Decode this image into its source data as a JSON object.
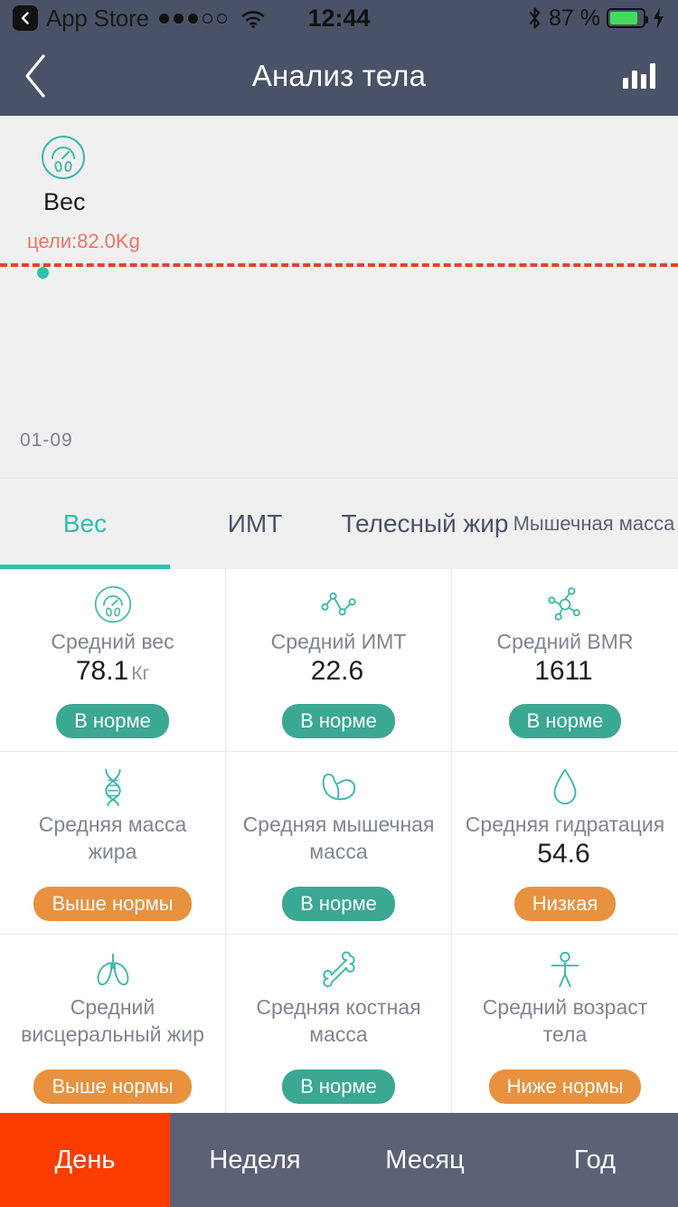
{
  "status_bar": {
    "back_app": "App Store",
    "signal_dots_filled": 3,
    "signal_dots_total": 5,
    "wifi_icon": "wifi-icon",
    "time": "12:44",
    "bluetooth_icon": "bluetooth-icon",
    "battery_percent": "87 %",
    "battery_level": 87,
    "charging_icon": "lightning-bolt-icon",
    "battery_color": "#44db5e"
  },
  "nav": {
    "back_icon": "chevron-left-icon",
    "title": "Анализ тела",
    "right_icon": "bar-chart-icon",
    "background": "#4a5268"
  },
  "chart_data": {
    "type": "scatter",
    "title": "Вес",
    "metric_icon": "body-scale-icon",
    "goal_label": "цели:82.0Kg",
    "goal_value": 82.0,
    "goal_unit": "Kg",
    "goal_line_color": "#e7412a",
    "point_color": "#30bfae",
    "categories": [
      "01-09"
    ],
    "x": [
      "01-09"
    ],
    "values": [
      81.4
    ],
    "series": [
      {
        "name": "Вес",
        "values": [
          81.4
        ]
      }
    ],
    "xlabel": "",
    "ylabel": "",
    "grid": false,
    "legend": "none",
    "annotations": [
      "цели:82.0Kg"
    ]
  },
  "tabs": {
    "active_index": 0,
    "accent": "#30bfae",
    "items": [
      {
        "label": "Вес"
      },
      {
        "label": "ИМТ"
      },
      {
        "label": "Телесный жир"
      },
      {
        "label": "Мышечная масса"
      }
    ]
  },
  "cards": [
    {
      "icon": "body-scale-icon",
      "title": "Средний вес",
      "value": "78.1",
      "unit": "Кг",
      "badge": "В норме",
      "badge_type": "ok"
    },
    {
      "icon": "line-chart-icon",
      "title": "Средний ИМТ",
      "value": "22.6",
      "unit": "",
      "badge": "В норме",
      "badge_type": "ok"
    },
    {
      "icon": "molecule-icon",
      "title": "Средний BMR",
      "value": "1611",
      "unit": "",
      "badge": "В норме",
      "badge_type": "ok"
    },
    {
      "icon": "dna-helix-icon",
      "title": "Средняя масса\nжира",
      "value": "",
      "unit": "",
      "badge": "Выше нормы",
      "badge_type": "warn"
    },
    {
      "icon": "flexed-biceps-icon",
      "title": "Средняя мышечная\nмасса",
      "value": "",
      "unit": "",
      "badge": "В норме",
      "badge_type": "ok"
    },
    {
      "icon": "water-drop-icon",
      "title": "Средняя гидратация",
      "value": "54.6",
      "unit": "",
      "badge": "Низкая",
      "badge_type": "warn"
    },
    {
      "icon": "lungs-icon",
      "title": "Средний\nвисцеральный жир",
      "value": "",
      "unit": "",
      "badge": "Выше нормы",
      "badge_type": "warn"
    },
    {
      "icon": "bone-icon",
      "title": "Средняя костная\nмасса",
      "value": "",
      "unit": "",
      "badge": "В норме",
      "badge_type": "ok"
    },
    {
      "icon": "standing-person-icon",
      "title": "Средний возраст\nтела",
      "value": "",
      "unit": "",
      "badge": "Ниже нормы",
      "badge_type": "warn"
    }
  ],
  "bottom_bar": {
    "active_index": 0,
    "active_color": "#fa3c00",
    "items": [
      {
        "label": "День"
      },
      {
        "label": "Неделя"
      },
      {
        "label": "Месяц"
      },
      {
        "label": "Год"
      }
    ]
  }
}
